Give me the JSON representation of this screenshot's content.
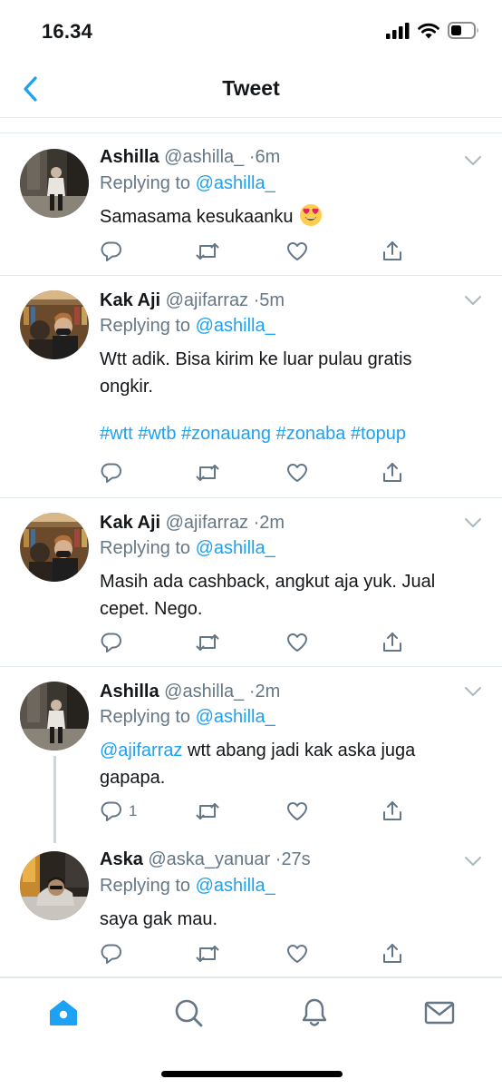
{
  "status_bar": {
    "time": "16.34"
  },
  "nav": {
    "title": "Tweet"
  },
  "tweets": [
    {
      "name": "Ashilla",
      "handle": "@ashilla_",
      "dot": "·",
      "time": "6m",
      "replying_prefix": "Replying to",
      "replying_to": "@ashilla_",
      "text": "Samasama kesukaanku",
      "emoji": "heart-eyes-emoji",
      "avatar": "avatar-ashilla",
      "reply_count": ""
    },
    {
      "name": "Kak Aji",
      "handle": "@ajifarraz",
      "dot": "·",
      "time": "5m",
      "replying_prefix": "Replying to",
      "replying_to": "@ashilla_",
      "text_line1": "Wtt adik. Bisa kirim ke luar pulau gratis",
      "text_line2": "ongkir.",
      "hashtags": "#wtt #wtb #zonauang #zonaba #topup",
      "avatar": "avatar-kak-aji",
      "reply_count": ""
    },
    {
      "name": "Kak Aji",
      "handle": "@ajifarraz",
      "dot": "·",
      "time": "2m",
      "replying_prefix": "Replying to",
      "replying_to": "@ashilla_",
      "text_line1": "Masih ada cashback, angkut aja yuk. Jual",
      "text_line2": "cepet. Nego.",
      "avatar": "avatar-kak-aji",
      "reply_count": ""
    },
    {
      "name": "Ashilla",
      "handle": "@ashilla_",
      "dot": "·",
      "time": "2m",
      "replying_prefix": "Replying to",
      "replying_to": "@ashilla_",
      "mention": "@ajifarraz",
      "text_line1_rest": " wtt abang jadi kak aska juga",
      "text_line2": "gapapa.",
      "avatar": "avatar-ashilla",
      "reply_count": "1"
    },
    {
      "name": "Aska",
      "handle": "@aska_yanuar",
      "dot": "·",
      "time": "27s",
      "replying_prefix": "Replying to",
      "replying_to": "@ashilla_",
      "text": "saya gak mau.",
      "avatar": "avatar-aska",
      "reply_count": ""
    }
  ],
  "tab_bar": {
    "items": [
      "home-icon",
      "search-icon",
      "notifications-icon",
      "messages-icon"
    ],
    "active": "home-icon"
  },
  "colors": {
    "accent": "#1da1f2",
    "secondary_text": "#657786",
    "divider": "#e1e8ed",
    "primary_text": "#14171a"
  }
}
